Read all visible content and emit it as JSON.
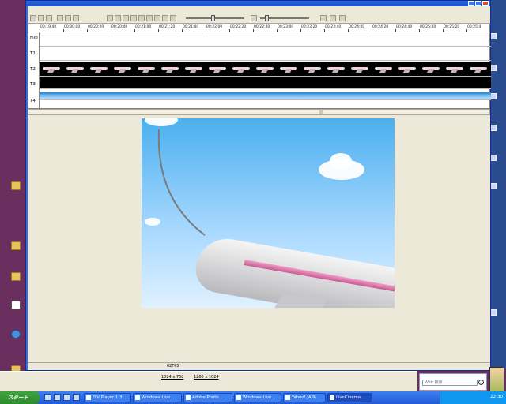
{
  "desktop": {
    "icons": [
      {
        "label": "",
        "kind": "folder"
      },
      {
        "label": "",
        "kind": "folder"
      },
      {
        "label": "",
        "kind": "folder"
      },
      {
        "label": "",
        "kind": "doc"
      },
      {
        "label": "",
        "kind": "web"
      },
      {
        "label": "",
        "kind": "folder"
      }
    ]
  },
  "right_strip": {
    "items": [
      "",
      "",
      "",
      "",
      "",
      "",
      ""
    ]
  },
  "window": {
    "title": "",
    "menu": [
      "",
      "",
      "",
      "",
      ""
    ]
  },
  "timeline": {
    "ruler": [
      "00:19:40",
      "00:30:00",
      "00:20:20",
      "00:20:40",
      "00:21:00",
      "00:21:20",
      "00:21:40",
      "00:22:00",
      "00:22:20",
      "00:22:40",
      "00:23:00",
      "00:23:20",
      "00:23:40",
      "00:24:00",
      "00:24:20",
      "00:24:40",
      "00:25:00",
      "00:25:20",
      "00:25:4"
    ],
    "tracks": [
      "Flip",
      "T1",
      "T2",
      "T3",
      "T4"
    ],
    "frame_count": 19
  },
  "status": {
    "fps": "62FPS"
  },
  "links": {
    "row1": [
      "",
      "",
      "",
      "",
      "1024 x 768",
      "1280 x 1024",
      "",
      "",
      "",
      "",
      "",
      ""
    ]
  },
  "search": {
    "placeholder": "Web 検索"
  },
  "taskbar": {
    "start_label": "スタート",
    "tasks": [
      {
        "label": "FLV Player 1.3...",
        "active": false
      },
      {
        "label": "Windows Live ...",
        "active": false
      },
      {
        "label": "Adobe Photo...",
        "active": false
      },
      {
        "label": "Windows Live ...",
        "active": false
      },
      {
        "label": "Yahoo! JAPA...",
        "active": false
      },
      {
        "label": "LiveCinema",
        "active": true
      }
    ],
    "clock": "22:30"
  },
  "colors": {
    "desktop": "#6b2f5f",
    "titlebar": "#1c50c8",
    "taskbar": "#225bd6",
    "start": "#2f8a2f"
  }
}
